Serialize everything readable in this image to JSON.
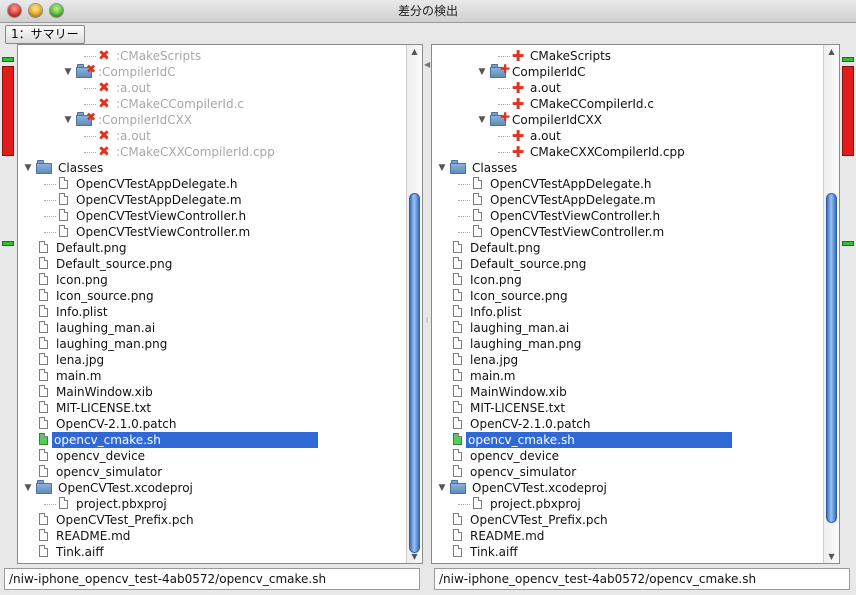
{
  "window": {
    "title": "差分の検出"
  },
  "toolbar": {
    "summary_button": "1：サマリー"
  },
  "left_tree": [
    {
      "label": ":CMakeScripts",
      "type": "file",
      "state": "removed",
      "level": 3
    },
    {
      "label": ":CompilerIdC",
      "type": "folder",
      "state": "removed",
      "level": 2,
      "expanded": true
    },
    {
      "label": ":a.out",
      "type": "file",
      "state": "removed",
      "level": 3
    },
    {
      "label": ":CMakeCCompilerId.c",
      "type": "file",
      "state": "removed",
      "level": 3
    },
    {
      "label": ":CompilerIdCXX",
      "type": "folder",
      "state": "removed",
      "level": 2,
      "expanded": true
    },
    {
      "label": ":a.out",
      "type": "file",
      "state": "removed",
      "level": 3
    },
    {
      "label": ":CMakeCXXCompilerId.cpp",
      "type": "file",
      "state": "removed",
      "level": 3
    },
    {
      "label": "Classes",
      "type": "folder",
      "state": "normal",
      "level": 0,
      "expanded": true
    },
    {
      "label": "OpenCVTestAppDelegate.h",
      "type": "file",
      "state": "normal",
      "level": 1
    },
    {
      "label": "OpenCVTestAppDelegate.m",
      "type": "file",
      "state": "normal",
      "level": 1
    },
    {
      "label": "OpenCVTestViewController.h",
      "type": "file",
      "state": "normal",
      "level": 1
    },
    {
      "label": "OpenCVTestViewController.m",
      "type": "file",
      "state": "normal",
      "level": 1
    },
    {
      "label": "Default.png",
      "type": "file",
      "state": "normal",
      "level": 0
    },
    {
      "label": "Default_source.png",
      "type": "file",
      "state": "normal",
      "level": 0
    },
    {
      "label": "Icon.png",
      "type": "file",
      "state": "normal",
      "level": 0
    },
    {
      "label": "Icon_source.png",
      "type": "file",
      "state": "normal",
      "level": 0
    },
    {
      "label": "Info.plist",
      "type": "file",
      "state": "normal",
      "level": 0
    },
    {
      "label": "laughing_man.ai",
      "type": "file",
      "state": "normal",
      "level": 0
    },
    {
      "label": "laughing_man.png",
      "type": "file",
      "state": "normal",
      "level": 0
    },
    {
      "label": "lena.jpg",
      "type": "file",
      "state": "normal",
      "level": 0
    },
    {
      "label": "main.m",
      "type": "file",
      "state": "normal",
      "level": 0
    },
    {
      "label": "MainWindow.xib",
      "type": "file",
      "state": "normal",
      "level": 0
    },
    {
      "label": "MIT-LICENSE.txt",
      "type": "file",
      "state": "normal",
      "level": 0
    },
    {
      "label": "OpenCV-2.1.0.patch",
      "type": "file",
      "state": "normal",
      "level": 0
    },
    {
      "label": "opencv_cmake.sh",
      "type": "file",
      "state": "changed",
      "level": 0,
      "selected": true
    },
    {
      "label": "opencv_device",
      "type": "file",
      "state": "normal",
      "level": 0
    },
    {
      "label": "opencv_simulator",
      "type": "file",
      "state": "normal",
      "level": 0
    },
    {
      "label": "OpenCVTest.xcodeproj",
      "type": "folder",
      "state": "normal",
      "level": 0,
      "expanded": true
    },
    {
      "label": "project.pbxproj",
      "type": "file",
      "state": "normal",
      "level": 1
    },
    {
      "label": "OpenCVTest_Prefix.pch",
      "type": "file",
      "state": "normal",
      "level": 0
    },
    {
      "label": "README.md",
      "type": "file",
      "state": "normal",
      "level": 0
    },
    {
      "label": "Tink.aiff",
      "type": "file",
      "state": "normal",
      "level": 0
    }
  ],
  "right_tree": [
    {
      "label": "CMakeScripts",
      "type": "file",
      "state": "added",
      "level": 3
    },
    {
      "label": "CompilerIdC",
      "type": "folder",
      "state": "added",
      "level": 2,
      "expanded": true
    },
    {
      "label": "a.out",
      "type": "file",
      "state": "added",
      "level": 3
    },
    {
      "label": "CMakeCCompilerId.c",
      "type": "file",
      "state": "added",
      "level": 3
    },
    {
      "label": "CompilerIdCXX",
      "type": "folder",
      "state": "added",
      "level": 2,
      "expanded": true
    },
    {
      "label": "a.out",
      "type": "file",
      "state": "added",
      "level": 3
    },
    {
      "label": "CMakeCXXCompilerId.cpp",
      "type": "file",
      "state": "added",
      "level": 3
    },
    {
      "label": "Classes",
      "type": "folder",
      "state": "normal",
      "level": 0,
      "expanded": true
    },
    {
      "label": "OpenCVTestAppDelegate.h",
      "type": "file",
      "state": "normal",
      "level": 1
    },
    {
      "label": "OpenCVTestAppDelegate.m",
      "type": "file",
      "state": "normal",
      "level": 1
    },
    {
      "label": "OpenCVTestViewController.h",
      "type": "file",
      "state": "normal",
      "level": 1
    },
    {
      "label": "OpenCVTestViewController.m",
      "type": "file",
      "state": "normal",
      "level": 1
    },
    {
      "label": "Default.png",
      "type": "file",
      "state": "normal",
      "level": 0
    },
    {
      "label": "Default_source.png",
      "type": "file",
      "state": "normal",
      "level": 0
    },
    {
      "label": "Icon.png",
      "type": "file",
      "state": "normal",
      "level": 0
    },
    {
      "label": "Icon_source.png",
      "type": "file",
      "state": "normal",
      "level": 0
    },
    {
      "label": "Info.plist",
      "type": "file",
      "state": "normal",
      "level": 0
    },
    {
      "label": "laughing_man.ai",
      "type": "file",
      "state": "normal",
      "level": 0
    },
    {
      "label": "laughing_man.png",
      "type": "file",
      "state": "normal",
      "level": 0
    },
    {
      "label": "lena.jpg",
      "type": "file",
      "state": "normal",
      "level": 0
    },
    {
      "label": "main.m",
      "type": "file",
      "state": "normal",
      "level": 0
    },
    {
      "label": "MainWindow.xib",
      "type": "file",
      "state": "normal",
      "level": 0
    },
    {
      "label": "MIT-LICENSE.txt",
      "type": "file",
      "state": "normal",
      "level": 0
    },
    {
      "label": "OpenCV-2.1.0.patch",
      "type": "file",
      "state": "normal",
      "level": 0
    },
    {
      "label": "opencv_cmake.sh",
      "type": "file",
      "state": "changed",
      "level": 0,
      "selected": true
    },
    {
      "label": "opencv_device",
      "type": "file",
      "state": "normal",
      "level": 0
    },
    {
      "label": "opencv_simulator",
      "type": "file",
      "state": "normal",
      "level": 0
    },
    {
      "label": "OpenCVTest.xcodeproj",
      "type": "folder",
      "state": "normal",
      "level": 0,
      "expanded": true
    },
    {
      "label": "project.pbxproj",
      "type": "file",
      "state": "normal",
      "level": 1
    },
    {
      "label": "OpenCVTest_Prefix.pch",
      "type": "file",
      "state": "normal",
      "level": 0
    },
    {
      "label": "README.md",
      "type": "file",
      "state": "normal",
      "level": 0
    },
    {
      "label": "Tink.aiff",
      "type": "file",
      "state": "normal",
      "level": 0
    }
  ],
  "path_left": "/niw-iphone_opencv_test-4ab0572/opencv_cmake.sh",
  "path_right": "/niw-iphone_opencv_test-4ab0572/opencv_cmake.sh",
  "colors": {
    "selection": "#3068d6",
    "change_marker": "#e21b1b",
    "same_marker": "#2fbf2f",
    "diff_icon": "#e0321e",
    "changed_file": "#58cc58"
  },
  "icons": {
    "removed": "cross-icon",
    "added": "plus-icon",
    "file": "file-icon",
    "folder": "folder-icon",
    "expanded": "triangle-down-icon"
  }
}
